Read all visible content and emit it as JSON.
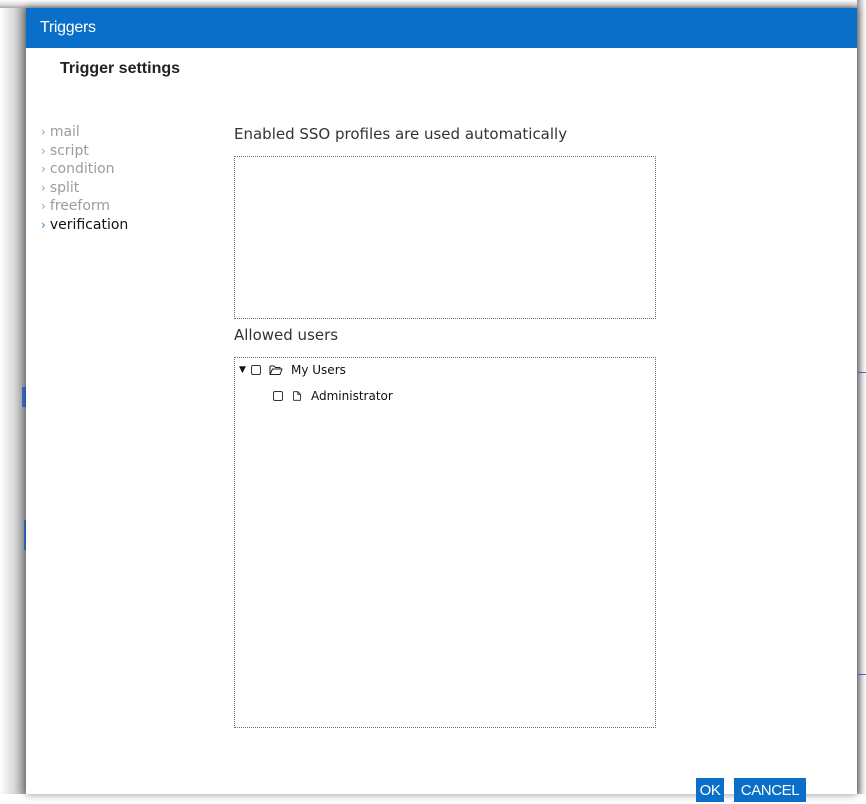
{
  "dialog": {
    "title": "Triggers",
    "heading": "Trigger settings"
  },
  "nav": {
    "chevron": "›",
    "items": [
      {
        "label": "mail",
        "active": false
      },
      {
        "label": "script",
        "active": false
      },
      {
        "label": "condition",
        "active": false
      },
      {
        "label": "split",
        "active": false
      },
      {
        "label": "freeform",
        "active": false
      },
      {
        "label": "verification",
        "active": true
      }
    ]
  },
  "sso": {
    "label": "Enabled SSO profiles are used automatically",
    "items": []
  },
  "users": {
    "label": "Allowed users",
    "tree": {
      "group": "My Users",
      "expanded": true,
      "children": [
        "Administrator"
      ]
    }
  },
  "buttons": {
    "ok": "OK",
    "cancel": "CANCEL"
  },
  "colors": {
    "accent": "#0a6fc9",
    "nav_inactive": "#9c9c9c",
    "nav_active": "#111111"
  },
  "icons": {
    "tree_toggle": "caret-down-icon",
    "group": "folder-open-icon",
    "leaf": "file-icon"
  }
}
